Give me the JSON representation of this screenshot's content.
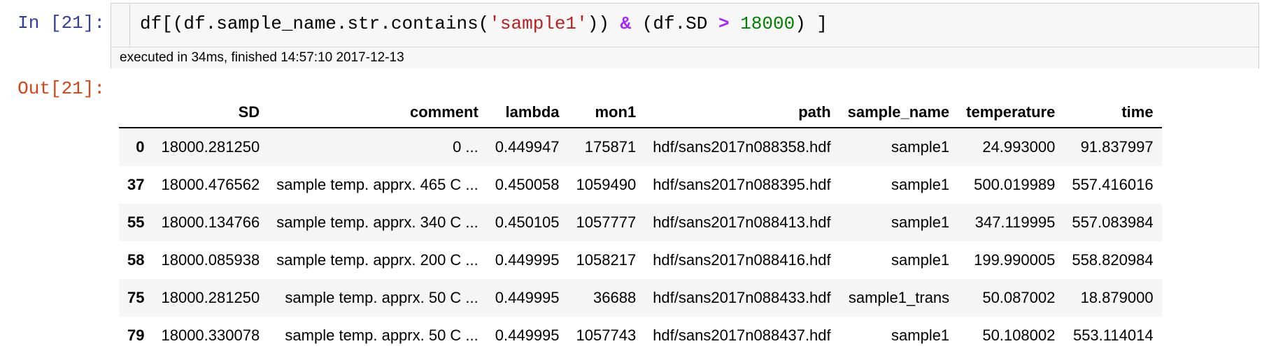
{
  "cell": {
    "in_prompt": "In [21]:",
    "out_prompt": "Out[21]:",
    "code": {
      "t1": "df[(df.sample_name.str.contains(",
      "t2": "'sample1'",
      "t3": ")) ",
      "t4": "&",
      "t5": " (df.SD ",
      "t6": ">",
      "t7": " ",
      "t8": "18000",
      "t9": ") ]"
    },
    "exec_info": "executed in 34ms, finished 14:57:10 2017-12-13"
  },
  "table": {
    "columns": [
      "",
      "SD",
      "comment",
      "lambda",
      "mon1",
      "path",
      "sample_name",
      "temperature",
      "time"
    ],
    "rows": [
      [
        "0",
        "18000.281250",
        "0 ...",
        "0.449947",
        "175871",
        "hdf/sans2017n088358.hdf",
        "sample1",
        "24.993000",
        "91.837997"
      ],
      [
        "37",
        "18000.476562",
        "sample temp. apprx. 465 C ...",
        "0.450058",
        "1059490",
        "hdf/sans2017n088395.hdf",
        "sample1",
        "500.019989",
        "557.416016"
      ],
      [
        "55",
        "18000.134766",
        "sample temp. apprx. 340 C ...",
        "0.450105",
        "1057777",
        "hdf/sans2017n088413.hdf",
        "sample1",
        "347.119995",
        "557.083984"
      ],
      [
        "58",
        "18000.085938",
        "sample temp. apprx. 200 C ...",
        "0.449995",
        "1058217",
        "hdf/sans2017n088416.hdf",
        "sample1",
        "199.990005",
        "558.820984"
      ],
      [
        "75",
        "18000.281250",
        "sample temp. apprx. 50 C ...",
        "0.449995",
        "36688",
        "hdf/sans2017n088433.hdf",
        "sample1_trans",
        "50.087002",
        "18.879000"
      ],
      [
        "79",
        "18000.330078",
        "sample temp. apprx. 50 C ...",
        "0.449995",
        "1057743",
        "hdf/sans2017n088437.hdf",
        "sample1",
        "50.108002",
        "553.114014"
      ]
    ]
  }
}
